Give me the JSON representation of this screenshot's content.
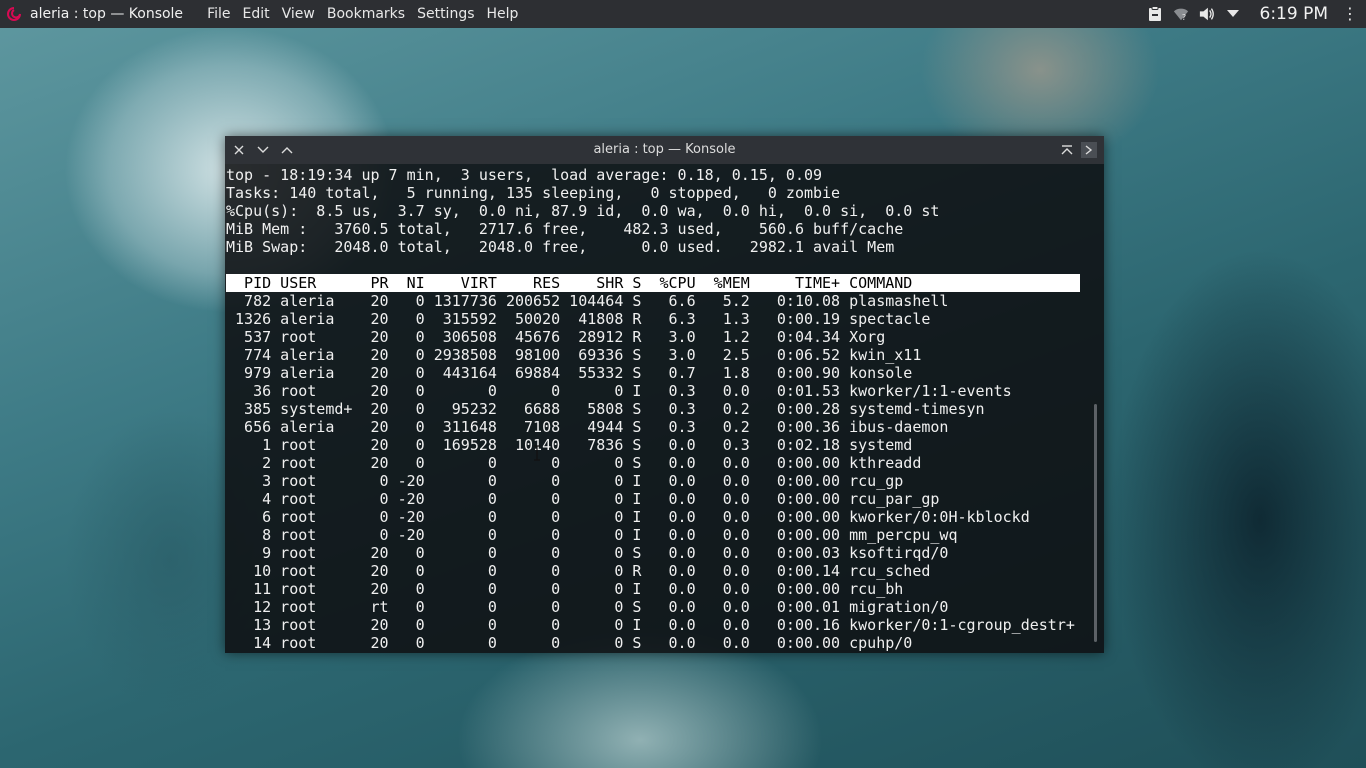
{
  "panel": {
    "app_title": "aleria : top — Konsole",
    "menu": [
      "File",
      "Edit",
      "View",
      "Bookmarks",
      "Settings",
      "Help"
    ],
    "clock": "6:19 PM",
    "tray_icons": [
      "clipboard-icon",
      "network-icon",
      "volume-icon",
      "chevron-down-icon"
    ]
  },
  "window": {
    "title": "aleria : top — Konsole",
    "buttons": [
      "close-icon",
      "minimize-icon",
      "maximize-icon",
      "keep-above-icon",
      "menu-icon"
    ]
  },
  "top": {
    "summary": [
      "top - 18:19:34 up 7 min,  3 users,  load average: 0.18, 0.15, 0.09",
      "Tasks: 140 total,   5 running, 135 sleeping,   0 stopped,   0 zombie",
      "%Cpu(s):  8.5 us,  3.7 sy,  0.0 ni, 87.9 id,  0.0 wa,  0.0 hi,  0.0 si,  0.0 st",
      "MiB Mem :   3760.5 total,   2717.6 free,    482.3 used,    560.6 buff/cache",
      "MiB Swap:   2048.0 total,   2048.0 free,      0.0 used.   2982.1 avail Mem"
    ],
    "columns": [
      "PID",
      "USER",
      "PR",
      "NI",
      "VIRT",
      "RES",
      "SHR",
      "S",
      "%CPU",
      "%MEM",
      "TIME+",
      "COMMAND"
    ],
    "processes": [
      [
        "782",
        "aleria",
        "20",
        "0",
        "1317736",
        "200652",
        "104464",
        "S",
        "6.6",
        "5.2",
        "0:10.08",
        "plasmashell"
      ],
      [
        "1326",
        "aleria",
        "20",
        "0",
        "315592",
        "50020",
        "41808",
        "R",
        "6.3",
        "1.3",
        "0:00.19",
        "spectacle"
      ],
      [
        "537",
        "root",
        "20",
        "0",
        "306508",
        "45676",
        "28912",
        "R",
        "3.0",
        "1.2",
        "0:04.34",
        "Xorg"
      ],
      [
        "774",
        "aleria",
        "20",
        "0",
        "2938508",
        "98100",
        "69336",
        "S",
        "3.0",
        "2.5",
        "0:06.52",
        "kwin_x11"
      ],
      [
        "979",
        "aleria",
        "20",
        "0",
        "443164",
        "69884",
        "55332",
        "S",
        "0.7",
        "1.8",
        "0:00.90",
        "konsole"
      ],
      [
        "36",
        "root",
        "20",
        "0",
        "0",
        "0",
        "0",
        "I",
        "0.3",
        "0.0",
        "0:01.53",
        "kworker/1:1-events"
      ],
      [
        "385",
        "systemd+",
        "20",
        "0",
        "95232",
        "6688",
        "5808",
        "S",
        "0.3",
        "0.2",
        "0:00.28",
        "systemd-timesyn"
      ],
      [
        "656",
        "aleria",
        "20",
        "0",
        "311648",
        "7108",
        "4944",
        "S",
        "0.3",
        "0.2",
        "0:00.36",
        "ibus-daemon"
      ],
      [
        "1",
        "root",
        "20",
        "0",
        "169528",
        "10140",
        "7836",
        "S",
        "0.0",
        "0.3",
        "0:02.18",
        "systemd"
      ],
      [
        "2",
        "root",
        "20",
        "0",
        "0",
        "0",
        "0",
        "S",
        "0.0",
        "0.0",
        "0:00.00",
        "kthreadd"
      ],
      [
        "3",
        "root",
        "0",
        "-20",
        "0",
        "0",
        "0",
        "I",
        "0.0",
        "0.0",
        "0:00.00",
        "rcu_gp"
      ],
      [
        "4",
        "root",
        "0",
        "-20",
        "0",
        "0",
        "0",
        "I",
        "0.0",
        "0.0",
        "0:00.00",
        "rcu_par_gp"
      ],
      [
        "6",
        "root",
        "0",
        "-20",
        "0",
        "0",
        "0",
        "I",
        "0.0",
        "0.0",
        "0:00.00",
        "kworker/0:0H-kblockd"
      ],
      [
        "8",
        "root",
        "0",
        "-20",
        "0",
        "0",
        "0",
        "I",
        "0.0",
        "0.0",
        "0:00.00",
        "mm_percpu_wq"
      ],
      [
        "9",
        "root",
        "20",
        "0",
        "0",
        "0",
        "0",
        "S",
        "0.0",
        "0.0",
        "0:00.03",
        "ksoftirqd/0"
      ],
      [
        "10",
        "root",
        "20",
        "0",
        "0",
        "0",
        "0",
        "R",
        "0.0",
        "0.0",
        "0:00.14",
        "rcu_sched"
      ],
      [
        "11",
        "root",
        "20",
        "0",
        "0",
        "0",
        "0",
        "I",
        "0.0",
        "0.0",
        "0:00.00",
        "rcu_bh"
      ],
      [
        "12",
        "root",
        "rt",
        "0",
        "0",
        "0",
        "0",
        "S",
        "0.0",
        "0.0",
        "0:00.01",
        "migration/0"
      ],
      [
        "13",
        "root",
        "20",
        "0",
        "0",
        "0",
        "0",
        "I",
        "0.0",
        "0.0",
        "0:00.16",
        "kworker/0:1-cgroup_destr+"
      ],
      [
        "14",
        "root",
        "20",
        "0",
        "0",
        "0",
        "0",
        "S",
        "0.0",
        "0.0",
        "0:00.00",
        "cpuhp/0"
      ]
    ]
  }
}
